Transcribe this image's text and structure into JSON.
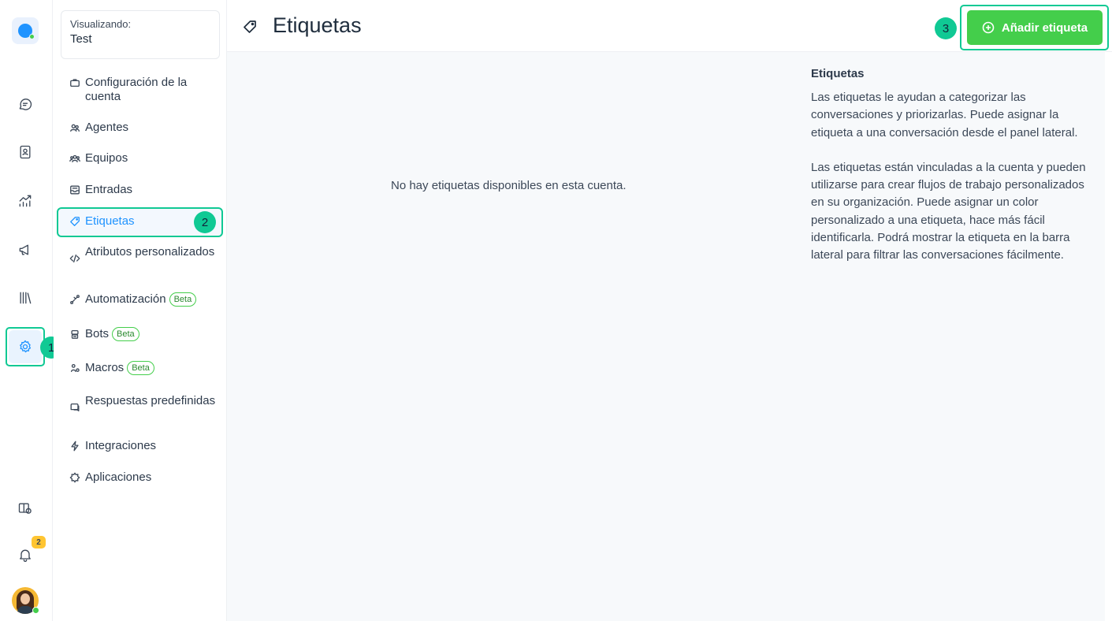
{
  "rail": {
    "items": [
      {
        "name": "conversations",
        "icon": "chat-bubble-icon"
      },
      {
        "name": "contacts",
        "icon": "contact-book-icon"
      },
      {
        "name": "reports",
        "icon": "chart-arrow-icon"
      },
      {
        "name": "campaigns",
        "icon": "megaphone-icon"
      },
      {
        "name": "library",
        "icon": "library-icon"
      },
      {
        "name": "settings",
        "icon": "gear-icon",
        "active": true
      }
    ],
    "notifications_count": "2"
  },
  "sidebar": {
    "account_label": "Visualizando:",
    "account_value": "Test",
    "items": [
      {
        "label": "Configuración de la cuenta",
        "icon": "briefcase-icon"
      },
      {
        "label": "Agentes",
        "icon": "people-icon"
      },
      {
        "label": "Equipos",
        "icon": "team-icon"
      },
      {
        "label": "Entradas",
        "icon": "inbox-icon"
      },
      {
        "label": "Etiquetas",
        "icon": "tag-icon",
        "active": true
      },
      {
        "label": "Atributos personalizados",
        "icon": "code-icon"
      },
      {
        "label": "Automatización",
        "icon": "automation-icon",
        "badge": "Beta"
      },
      {
        "label": "Bots",
        "icon": "bot-icon",
        "badge": "Beta"
      },
      {
        "label": "Macros",
        "icon": "macro-icon",
        "badge": "Beta"
      },
      {
        "label": "Respuestas predefinidas",
        "icon": "canned-response-icon"
      },
      {
        "label": "Integraciones",
        "icon": "flash-icon"
      },
      {
        "label": "Aplicaciones",
        "icon": "puzzle-icon"
      }
    ]
  },
  "header": {
    "title": "Etiquetas",
    "add_button": "Añadir etiqueta"
  },
  "main": {
    "empty_message": "No hay etiquetas disponibles en esta cuenta.",
    "help_title": "Etiquetas",
    "help_paragraph_1": "Las etiquetas le ayudan a categorizar las conversaciones y priorizarlas. Puede asignar la etiqueta a una conversación desde el panel lateral.",
    "help_paragraph_2": "Las etiquetas están vinculadas a la cuenta y pueden utilizarse para crear flujos de trabajo personalizados en su organización. Puede asignar un color personalizado a una etiqueta, hace más fácil identificarla. Podrá mostrar la etiqueta en la barra lateral para filtrar las conversaciones fácilmente."
  },
  "steps": [
    "1",
    "2",
    "3"
  ],
  "colors": {
    "accent": "#1f93ff",
    "success": "#44ce4b",
    "highlight": "#10c994",
    "badge": "#ffc532"
  }
}
